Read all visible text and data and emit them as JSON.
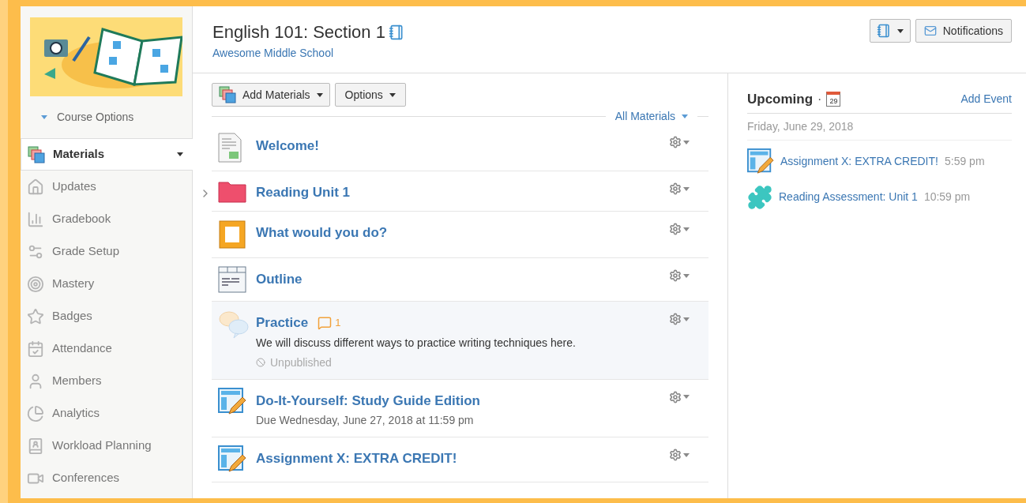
{
  "sidebar": {
    "course_options": "Course Options",
    "items": [
      {
        "label": "Materials",
        "selected": true,
        "kind": "materials"
      },
      {
        "label": "Updates",
        "selected": false,
        "kind": "updates"
      },
      {
        "label": "Gradebook",
        "selected": false,
        "kind": "gradebook"
      },
      {
        "label": "Grade Setup",
        "selected": false,
        "kind": "gradesetup"
      },
      {
        "label": "Mastery",
        "selected": false,
        "kind": "mastery"
      },
      {
        "label": "Badges",
        "selected": false,
        "kind": "badges"
      },
      {
        "label": "Attendance",
        "selected": false,
        "kind": "attendance"
      },
      {
        "label": "Members",
        "selected": false,
        "kind": "members"
      },
      {
        "label": "Analytics",
        "selected": false,
        "kind": "analytics"
      },
      {
        "label": "Workload Planning",
        "selected": false,
        "kind": "workload"
      },
      {
        "label": "Conferences",
        "selected": false,
        "kind": "conferences"
      }
    ]
  },
  "header": {
    "title": "English 101: Section 1",
    "school": "Awesome Middle School",
    "notifications_button": "Notifications"
  },
  "toolbar": {
    "add_materials": "Add Materials",
    "options": "Options",
    "filter": "All Materials"
  },
  "materials": [
    {
      "kind": "document",
      "title": "Welcome!",
      "expandable": false
    },
    {
      "kind": "folder",
      "title": "Reading Unit 1",
      "expandable": true
    },
    {
      "kind": "page",
      "title": "What would you do?",
      "expandable": false
    },
    {
      "kind": "outline",
      "title": "Outline",
      "expandable": false
    },
    {
      "kind": "discussion",
      "title": "Practice",
      "comments": "1",
      "description": "We will discuss different ways to practice writing techniques here.",
      "status": "Unpublished",
      "expandable": false
    },
    {
      "kind": "assignment",
      "title": "Do-It-Yourself: Study Guide Edition",
      "due": "Due Wednesday, June 27, 2018 at 11:59 pm",
      "expandable": false
    },
    {
      "kind": "assignment",
      "title": "Assignment X: EXTRA CREDIT!",
      "expandable": false
    }
  ],
  "upcoming": {
    "title": "Upcoming",
    "separator": "·",
    "add_event": "Add Event",
    "calendar_day": "29",
    "date": "Friday, June 29, 2018",
    "events": [
      {
        "kind": "assignment",
        "title": "Assignment X: EXTRA CREDIT!",
        "time": "5:59 pm"
      },
      {
        "kind": "assessment",
        "title": "Reading Assessment: Unit 1",
        "time": "10:59 pm"
      }
    ]
  }
}
